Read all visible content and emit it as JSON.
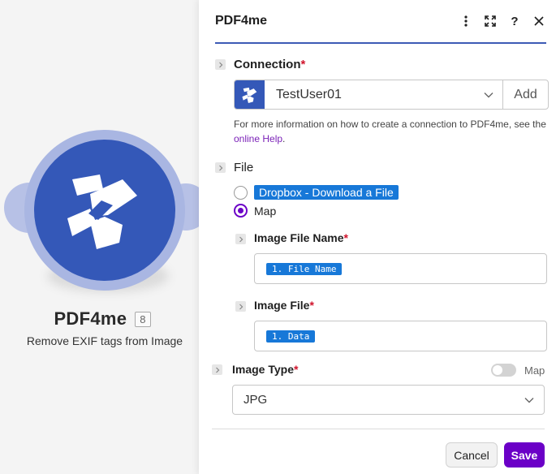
{
  "module": {
    "name": "PDF4me",
    "badge": "8",
    "subtitle": "Remove EXIF tags from Image"
  },
  "panel": {
    "title": "PDF4me",
    "icons": [
      "more-vertical-icon",
      "expand-icon",
      "help-icon",
      "close-icon"
    ],
    "help_symbol": "?",
    "connection": {
      "label": "Connection",
      "required": "*",
      "value": "TestUser01",
      "add_label": "Add",
      "help_text": "For more information on how to create a connection to PDF4me, see the ",
      "help_link": "online Help",
      "help_end": "."
    },
    "file": {
      "label": "File",
      "options": [
        {
          "label": "Dropbox - Download a File",
          "selected": false
        },
        {
          "label": "Map",
          "selected": true
        }
      ]
    },
    "image_file_name": {
      "label": "Image File Name",
      "required": "*",
      "token": "1. File Name"
    },
    "image_file": {
      "label": "Image File",
      "required": "*",
      "token": "1. Data"
    },
    "image_type": {
      "label": "Image Type",
      "required": "*",
      "value": "JPG",
      "map_label": "Map",
      "map_enabled": false
    },
    "buttons": {
      "cancel": "Cancel",
      "save": "Save"
    }
  },
  "colors": {
    "brand": "#3458b8",
    "accent": "#6b00c7",
    "token": "#1778d8",
    "required": "#d0142c"
  }
}
